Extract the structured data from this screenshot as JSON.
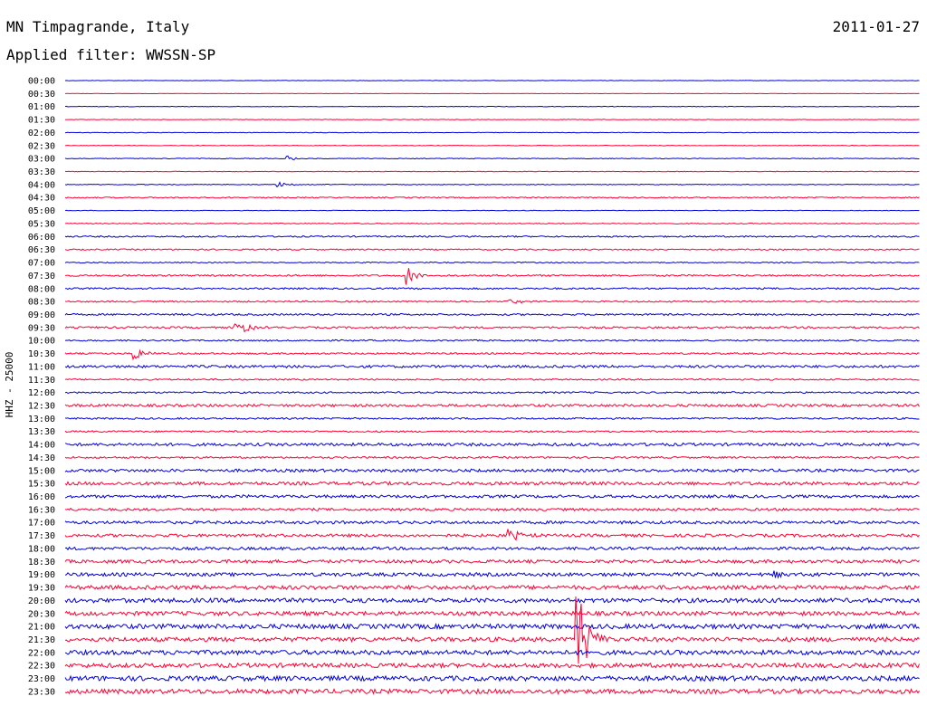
{
  "header": {
    "station": "MN Timpagrande, Italy",
    "date": "2011-01-27",
    "filter": "Applied filter: WWSSN-SP"
  },
  "chart_data": {
    "type": "line",
    "title": "MN Timpagrande, Italy",
    "ylabel": "HHZ - 25000",
    "row_labels": [
      "00:00",
      "00:30",
      "01:00",
      "01:30",
      "02:00",
      "02:30",
      "03:00",
      "03:30",
      "04:00",
      "04:30",
      "05:00",
      "05:30",
      "06:00",
      "06:30",
      "07:00",
      "07:30",
      "08:00",
      "08:30",
      "09:00",
      "09:30",
      "10:00",
      "10:30",
      "11:00",
      "11:30",
      "12:00",
      "12:30",
      "13:00",
      "13:30",
      "14:00",
      "14:30",
      "15:00",
      "15:30",
      "16:00",
      "16:30",
      "17:00",
      "17:30",
      "18:00",
      "18:30",
      "19:00",
      "19:30",
      "20:00",
      "20:30",
      "21:00",
      "21:30",
      "22:00",
      "22:30",
      "23:00",
      "23:30"
    ],
    "colors": {
      "even_rows": "#0000dd",
      "odd_rows": "#ff0033"
    },
    "noise_levels": [
      0.2,
      0.2,
      0.3,
      0.3,
      0.3,
      0.3,
      0.4,
      0.3,
      0.4,
      0.6,
      0.3,
      0.5,
      0.8,
      0.7,
      0.6,
      0.9,
      0.9,
      0.8,
      1.0,
      1.0,
      0.8,
      0.9,
      1.4,
      0.8,
      0.9,
      1.4,
      0.9,
      0.9,
      1.6,
      1.0,
      1.6,
      1.8,
      1.6,
      1.4,
      1.6,
      1.6,
      1.6,
      1.8,
      1.9,
      2.2,
      2.4,
      2.3,
      2.6,
      2.4,
      2.5,
      2.4,
      2.7,
      2.5
    ],
    "events": [
      {
        "row": "03:00",
        "x_fraction": 0.26,
        "amplitude": 3
      },
      {
        "row": "04:00",
        "x_fraction": 0.25,
        "amplitude": 3
      },
      {
        "row": "07:30",
        "x_fraction": 0.4,
        "amplitude": 10
      },
      {
        "row": "08:30",
        "x_fraction": 0.52,
        "amplitude": 5
      },
      {
        "row": "09:30",
        "x_fraction": 0.2,
        "amplitude": 12
      },
      {
        "row": "10:30",
        "x_fraction": 0.08,
        "amplitude": 10
      },
      {
        "row": "17:30",
        "x_fraction": 0.52,
        "amplitude": 8
      },
      {
        "row": "19:00",
        "x_fraction": 0.83,
        "amplitude": 4
      },
      {
        "row": "21:30",
        "x_fraction": 0.598,
        "amplitude": 75
      }
    ]
  }
}
